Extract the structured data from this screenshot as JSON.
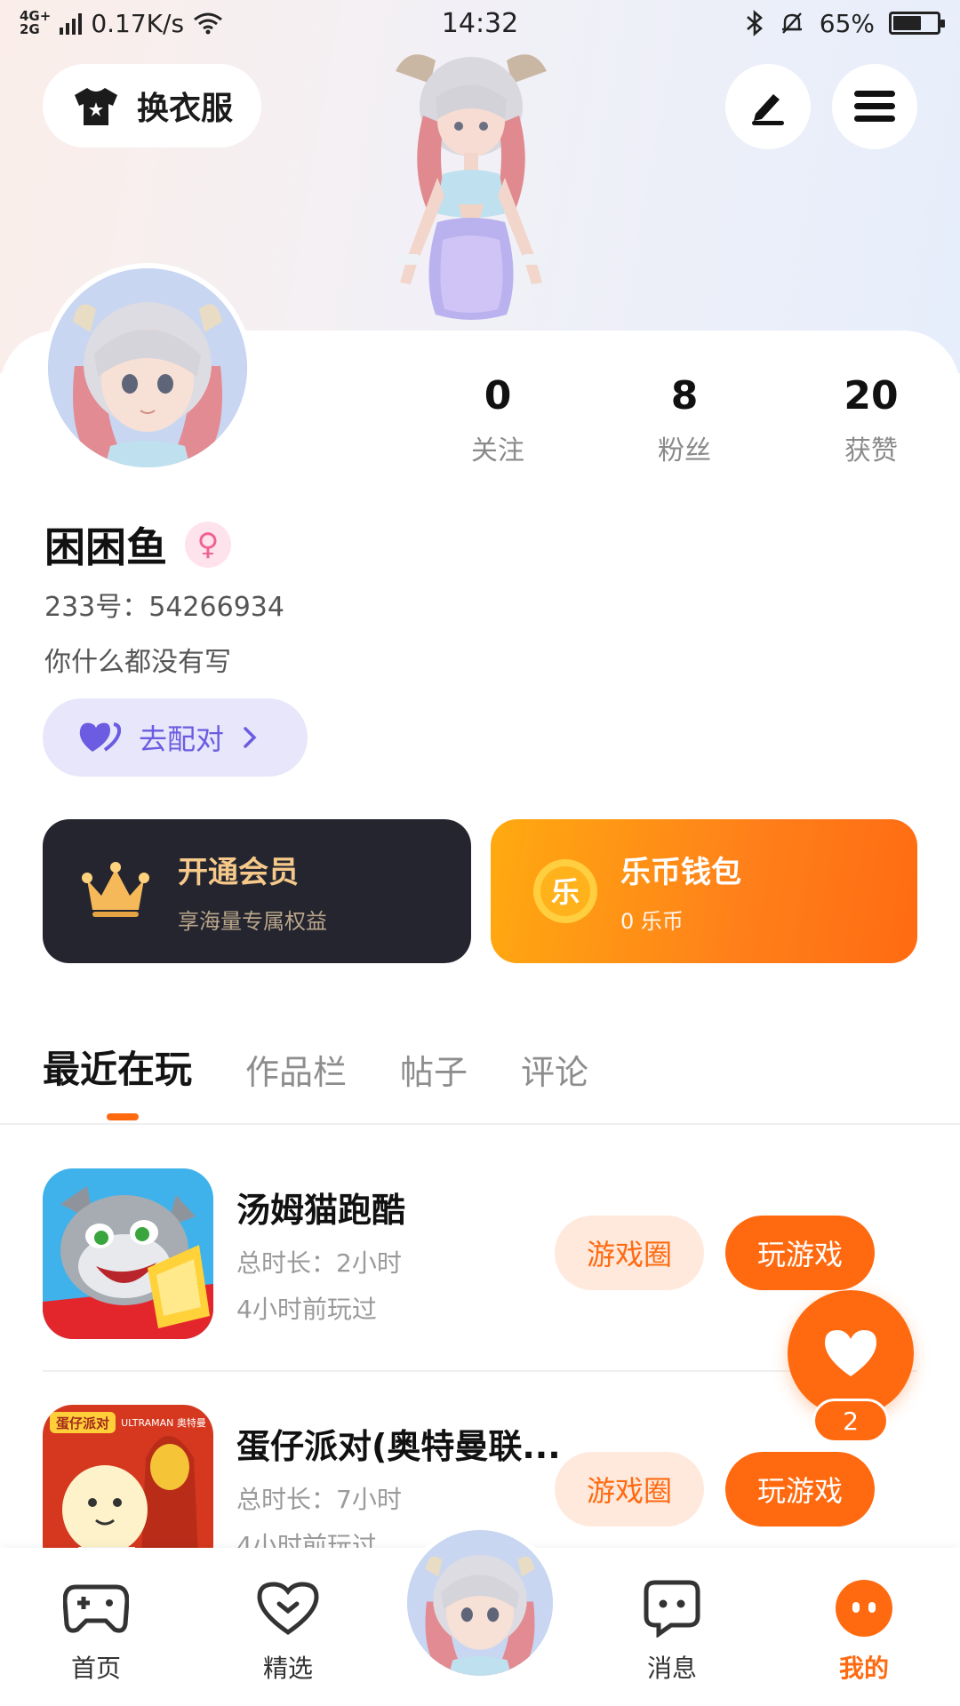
{
  "status_bar": {
    "network_top": "4G+",
    "network_bottom": "2G",
    "speed": "0.17K/s",
    "time": "14:32",
    "battery": "65%",
    "battery_level": 0.65
  },
  "header": {
    "outfit_label": "换衣服",
    "icons": [
      "shirt-icon",
      "edit-icon",
      "menu-icon"
    ]
  },
  "profile": {
    "stats": [
      {
        "value": "0",
        "label": "关注"
      },
      {
        "value": "8",
        "label": "粉丝"
      },
      {
        "value": "20",
        "label": "获赞"
      }
    ],
    "username": "困困鱼",
    "gender_symbol": "♀",
    "uid": "233号：54266934",
    "bio": "你什么都没有写",
    "match_label": "去配对"
  },
  "promo": {
    "vip_title": "开通会员",
    "vip_sub": "享海量专属权益",
    "wallet_title": "乐币钱包",
    "wallet_sub": "0 乐币",
    "wallet_coin": "乐"
  },
  "tabs": [
    "最近在玩",
    "作品栏",
    "帖子",
    "评论"
  ],
  "games": [
    {
      "name": "汤姆猫跑酷",
      "duration": "总时长：2小时",
      "last_played": "4小时前玩过",
      "circle_label": "游戏圈",
      "play_label": "玩游戏"
    },
    {
      "name": "蛋仔派对(奥特曼联...",
      "duration": "总时长：7小时",
      "last_played": "4小时前玩过",
      "circle_label": "游戏圈",
      "play_label": "玩游戏"
    }
  ],
  "game2_icon_text": {
    "brand": "蛋仔派对",
    "collab": "ULTRAMAN 奥特曼"
  },
  "fab": {
    "count": "2"
  },
  "bottom_nav": [
    {
      "label": "首页"
    },
    {
      "label": "精选"
    },
    {
      "label": "消息"
    },
    {
      "label": "我的"
    }
  ],
  "colors": {
    "accent": "#ff6a10",
    "match": "#6b5ce1",
    "vip_bg": "#24252f",
    "gold": "#f6c98a"
  }
}
